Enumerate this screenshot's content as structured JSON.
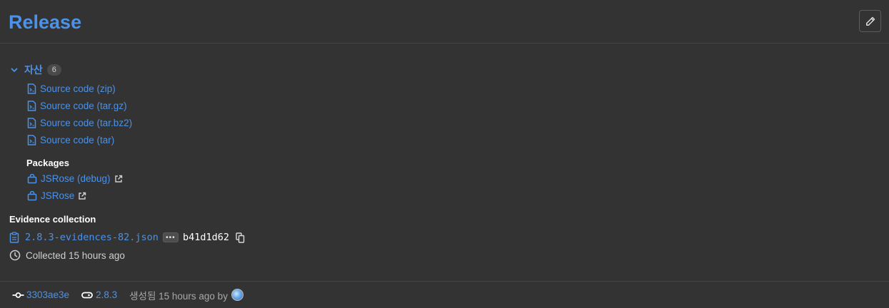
{
  "header": {
    "title": "Release"
  },
  "assets": {
    "label": "자산",
    "count": "6",
    "sources": [
      {
        "label": "Source code (zip)"
      },
      {
        "label": "Source code (tar.gz)"
      },
      {
        "label": "Source code (tar.bz2)"
      },
      {
        "label": "Source code (tar)"
      }
    ],
    "packages_label": "Packages",
    "packages": [
      {
        "label": "JSRose (debug)"
      },
      {
        "label": "JSRose"
      }
    ]
  },
  "evidence": {
    "section_label": "Evidence collection",
    "file": "2.8.3-evidences-82.json",
    "ellipsis": "•••",
    "sha": "b41d1d62",
    "collected": "Collected 15 hours ago"
  },
  "footer": {
    "commit": "3303ae3e",
    "tag": "2.8.3",
    "created": "생성됨 15 hours ago by"
  },
  "colors": {
    "link": "#4b92e8",
    "background": "#333333",
    "text": "#ececef",
    "muted": "#a8a8a8"
  }
}
